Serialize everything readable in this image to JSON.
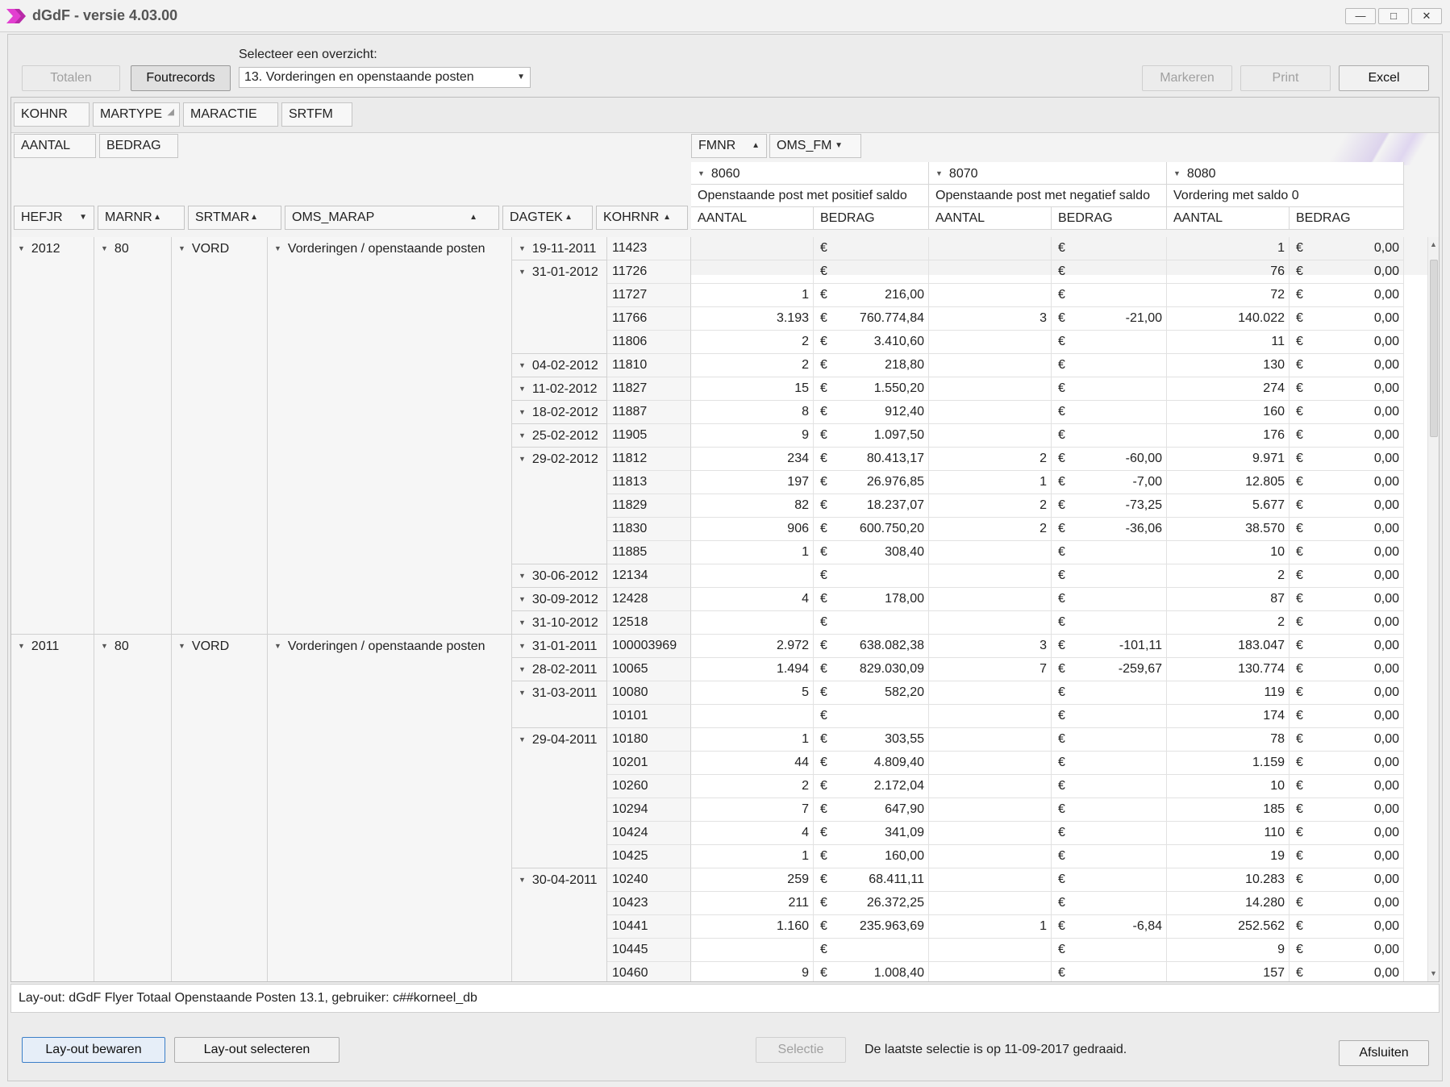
{
  "window": {
    "title": "dGdF - versie 4.03.00",
    "controls": [
      "minimize-icon",
      "maximize-icon",
      "close-icon"
    ],
    "accent": "#e23fd0"
  },
  "toolbar": {
    "totalen": "Totalen",
    "foutrecords": "Foutrecords",
    "select_label": "Selecteer een overzicht:",
    "select_value": "13.  Vorderingen en openstaande posten",
    "markeren": "Markeren",
    "print": "Print",
    "excel": "Excel"
  },
  "pivot": {
    "filter_fields": [
      "KOHNR",
      "MARTYPE",
      "MARACTIE",
      "SRTFM"
    ],
    "data_fields": [
      "AANTAL",
      "BEDRAG"
    ],
    "column_fields": [
      "FMNR",
      "OMS_FM"
    ],
    "row_fields": [
      "HEFJR",
      "MARNR",
      "SRTMAR",
      "OMS_MARAP",
      "DAGTEK",
      "KOHRNR"
    ],
    "columns": [
      {
        "fmnr": "8060",
        "oms": "Openstaande post met positief saldo"
      },
      {
        "fmnr": "8070",
        "oms": "Openstaande post met negatief saldo"
      },
      {
        "fmnr": "8080",
        "oms": "Vordering met saldo 0"
      }
    ],
    "measure_labels": {
      "aantal": "AANTAL",
      "bedrag": "BEDRAG"
    },
    "currency": "€",
    "groups": [
      {
        "hefjr": "2012",
        "marnr": "80",
        "srtmar": "VORD",
        "oms": "Vorderingen / openstaande posten"
      },
      {
        "hefjr": "2011",
        "marnr": "80",
        "srtmar": "VORD",
        "oms": "Vorderingen / openstaande posten"
      }
    ],
    "rows": [
      {
        "g": 0,
        "d": "19-11-2011",
        "k": "11423",
        "a1": "",
        "b1": "",
        "a2": "",
        "b2": "",
        "a3": "1",
        "b3": "0,00"
      },
      {
        "g": 0,
        "d": "31-01-2012",
        "k": "11726",
        "a1": "",
        "b1": "",
        "a2": "",
        "b2": "",
        "a3": "76",
        "b3": "0,00"
      },
      {
        "g": 0,
        "d": "",
        "k": "11727",
        "a1": "1",
        "b1": "216,00",
        "a2": "",
        "b2": "",
        "a3": "72",
        "b3": "0,00"
      },
      {
        "g": 0,
        "d": "",
        "k": "11766",
        "a1": "3.193",
        "b1": "760.774,84",
        "a2": "3",
        "b2": "-21,00",
        "a3": "140.022",
        "b3": "0,00"
      },
      {
        "g": 0,
        "d": "",
        "k": "11806",
        "a1": "2",
        "b1": "3.410,60",
        "a2": "",
        "b2": "",
        "a3": "11",
        "b3": "0,00"
      },
      {
        "g": 0,
        "d": "04-02-2012",
        "k": "11810",
        "a1": "2",
        "b1": "218,80",
        "a2": "",
        "b2": "",
        "a3": "130",
        "b3": "0,00"
      },
      {
        "g": 0,
        "d": "11-02-2012",
        "k": "11827",
        "a1": "15",
        "b1": "1.550,20",
        "a2": "",
        "b2": "",
        "a3": "274",
        "b3": "0,00"
      },
      {
        "g": 0,
        "d": "18-02-2012",
        "k": "11887",
        "a1": "8",
        "b1": "912,40",
        "a2": "",
        "b2": "",
        "a3": "160",
        "b3": "0,00"
      },
      {
        "g": 0,
        "d": "25-02-2012",
        "k": "11905",
        "a1": "9",
        "b1": "1.097,50",
        "a2": "",
        "b2": "",
        "a3": "176",
        "b3": "0,00"
      },
      {
        "g": 0,
        "d": "29-02-2012",
        "k": "11812",
        "a1": "234",
        "b1": "80.413,17",
        "a2": "2",
        "b2": "-60,00",
        "a3": "9.971",
        "b3": "0,00"
      },
      {
        "g": 0,
        "d": "",
        "k": "11813",
        "a1": "197",
        "b1": "26.976,85",
        "a2": "1",
        "b2": "-7,00",
        "a3": "12.805",
        "b3": "0,00"
      },
      {
        "g": 0,
        "d": "",
        "k": "11829",
        "a1": "82",
        "b1": "18.237,07",
        "a2": "2",
        "b2": "-73,25",
        "a3": "5.677",
        "b3": "0,00"
      },
      {
        "g": 0,
        "d": "",
        "k": "11830",
        "a1": "906",
        "b1": "600.750,20",
        "a2": "2",
        "b2": "-36,06",
        "a3": "38.570",
        "b3": "0,00"
      },
      {
        "g": 0,
        "d": "",
        "k": "11885",
        "a1": "1",
        "b1": "308,40",
        "a2": "",
        "b2": "",
        "a3": "10",
        "b3": "0,00"
      },
      {
        "g": 0,
        "d": "30-06-2012",
        "k": "12134",
        "a1": "",
        "b1": "",
        "a2": "",
        "b2": "",
        "a3": "2",
        "b3": "0,00"
      },
      {
        "g": 0,
        "d": "30-09-2012",
        "k": "12428",
        "a1": "4",
        "b1": "178,00",
        "a2": "",
        "b2": "",
        "a3": "87",
        "b3": "0,00"
      },
      {
        "g": 0,
        "d": "31-10-2012",
        "k": "12518",
        "a1": "",
        "b1": "",
        "a2": "",
        "b2": "",
        "a3": "2",
        "b3": "0,00"
      },
      {
        "g": 1,
        "d": "31-01-2011",
        "k": "100003969",
        "a1": "2.972",
        "b1": "638.082,38",
        "a2": "3",
        "b2": "-101,11",
        "a3": "183.047",
        "b3": "0,00"
      },
      {
        "g": 1,
        "d": "28-02-2011",
        "k": "10065",
        "a1": "1.494",
        "b1": "829.030,09",
        "a2": "7",
        "b2": "-259,67",
        "a3": "130.774",
        "b3": "0,00"
      },
      {
        "g": 1,
        "d": "31-03-2011",
        "k": "10080",
        "a1": "5",
        "b1": "582,20",
        "a2": "",
        "b2": "",
        "a3": "119",
        "b3": "0,00"
      },
      {
        "g": 1,
        "d": "",
        "k": "10101",
        "a1": "",
        "b1": "",
        "a2": "",
        "b2": "",
        "a3": "174",
        "b3": "0,00"
      },
      {
        "g": 1,
        "d": "29-04-2011",
        "k": "10180",
        "a1": "1",
        "b1": "303,55",
        "a2": "",
        "b2": "",
        "a3": "78",
        "b3": "0,00"
      },
      {
        "g": 1,
        "d": "",
        "k": "10201",
        "a1": "44",
        "b1": "4.809,40",
        "a2": "",
        "b2": "",
        "a3": "1.159",
        "b3": "0,00"
      },
      {
        "g": 1,
        "d": "",
        "k": "10260",
        "a1": "2",
        "b1": "2.172,04",
        "a2": "",
        "b2": "",
        "a3": "10",
        "b3": "0,00"
      },
      {
        "g": 1,
        "d": "",
        "k": "10294",
        "a1": "7",
        "b1": "647,90",
        "a2": "",
        "b2": "",
        "a3": "185",
        "b3": "0,00"
      },
      {
        "g": 1,
        "d": "",
        "k": "10424",
        "a1": "4",
        "b1": "341,09",
        "a2": "",
        "b2": "",
        "a3": "110",
        "b3": "0,00"
      },
      {
        "g": 1,
        "d": "",
        "k": "10425",
        "a1": "1",
        "b1": "160,00",
        "a2": "",
        "b2": "",
        "a3": "19",
        "b3": "0,00"
      },
      {
        "g": 1,
        "d": "30-04-2011",
        "k": "10240",
        "a1": "259",
        "b1": "68.411,11",
        "a2": "",
        "b2": "",
        "a3": "10.283",
        "b3": "0,00"
      },
      {
        "g": 1,
        "d": "",
        "k": "10423",
        "a1": "211",
        "b1": "26.372,25",
        "a2": "",
        "b2": "",
        "a3": "14.280",
        "b3": "0,00"
      },
      {
        "g": 1,
        "d": "",
        "k": "10441",
        "a1": "1.160",
        "b1": "235.963,69",
        "a2": "1",
        "b2": "-6,84",
        "a3": "252.562",
        "b3": "0,00"
      },
      {
        "g": 1,
        "d": "",
        "k": "10445",
        "a1": "",
        "b1": "",
        "a2": "",
        "b2": "",
        "a3": "9",
        "b3": "0,00"
      },
      {
        "g": 1,
        "d": "",
        "k": "10460",
        "a1": "9",
        "b1": "1.008,40",
        "a2": "",
        "b2": "",
        "a3": "157",
        "b3": "0,00"
      }
    ]
  },
  "layout_info": "Lay-out: dGdF Flyer Totaal Openstaande Posten 13.1, gebruiker: c##korneel_db",
  "footer": {
    "layout_save": "Lay-out bewaren",
    "layout_select": "Lay-out selecteren",
    "selectie": "Selectie",
    "status": "De laatste selectie is op 11-09-2017 gedraaid.",
    "afsluiten": "Afsluiten"
  }
}
